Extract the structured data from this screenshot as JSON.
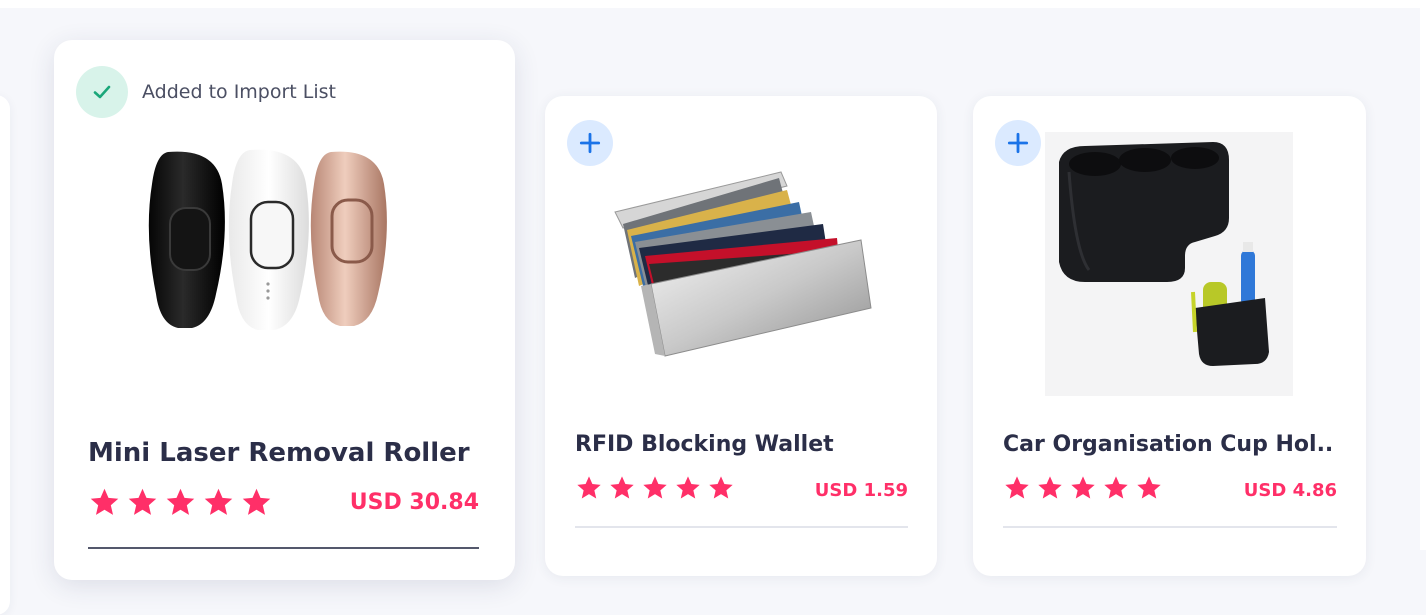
{
  "products": [
    {
      "title": "Mini Laser Removal Roller",
      "price": "USD 30.84",
      "rating": 5,
      "status": "Added to Import List",
      "added": true
    },
    {
      "title": "RFID Blocking Wallet",
      "price": "USD 1.59",
      "rating": 5,
      "added": false
    },
    {
      "title": "Car Organisation Cup Hol...",
      "price": "USD 4.86",
      "rating": 5,
      "added": false
    }
  ],
  "colors": {
    "accent_price": "#ff2f68",
    "star": "#ff2f68",
    "added_check": "#1aa77a",
    "plus": "#1a73e8"
  },
  "icons": {
    "added": "check-icon",
    "add": "plus-icon",
    "rating": "star-icon"
  }
}
